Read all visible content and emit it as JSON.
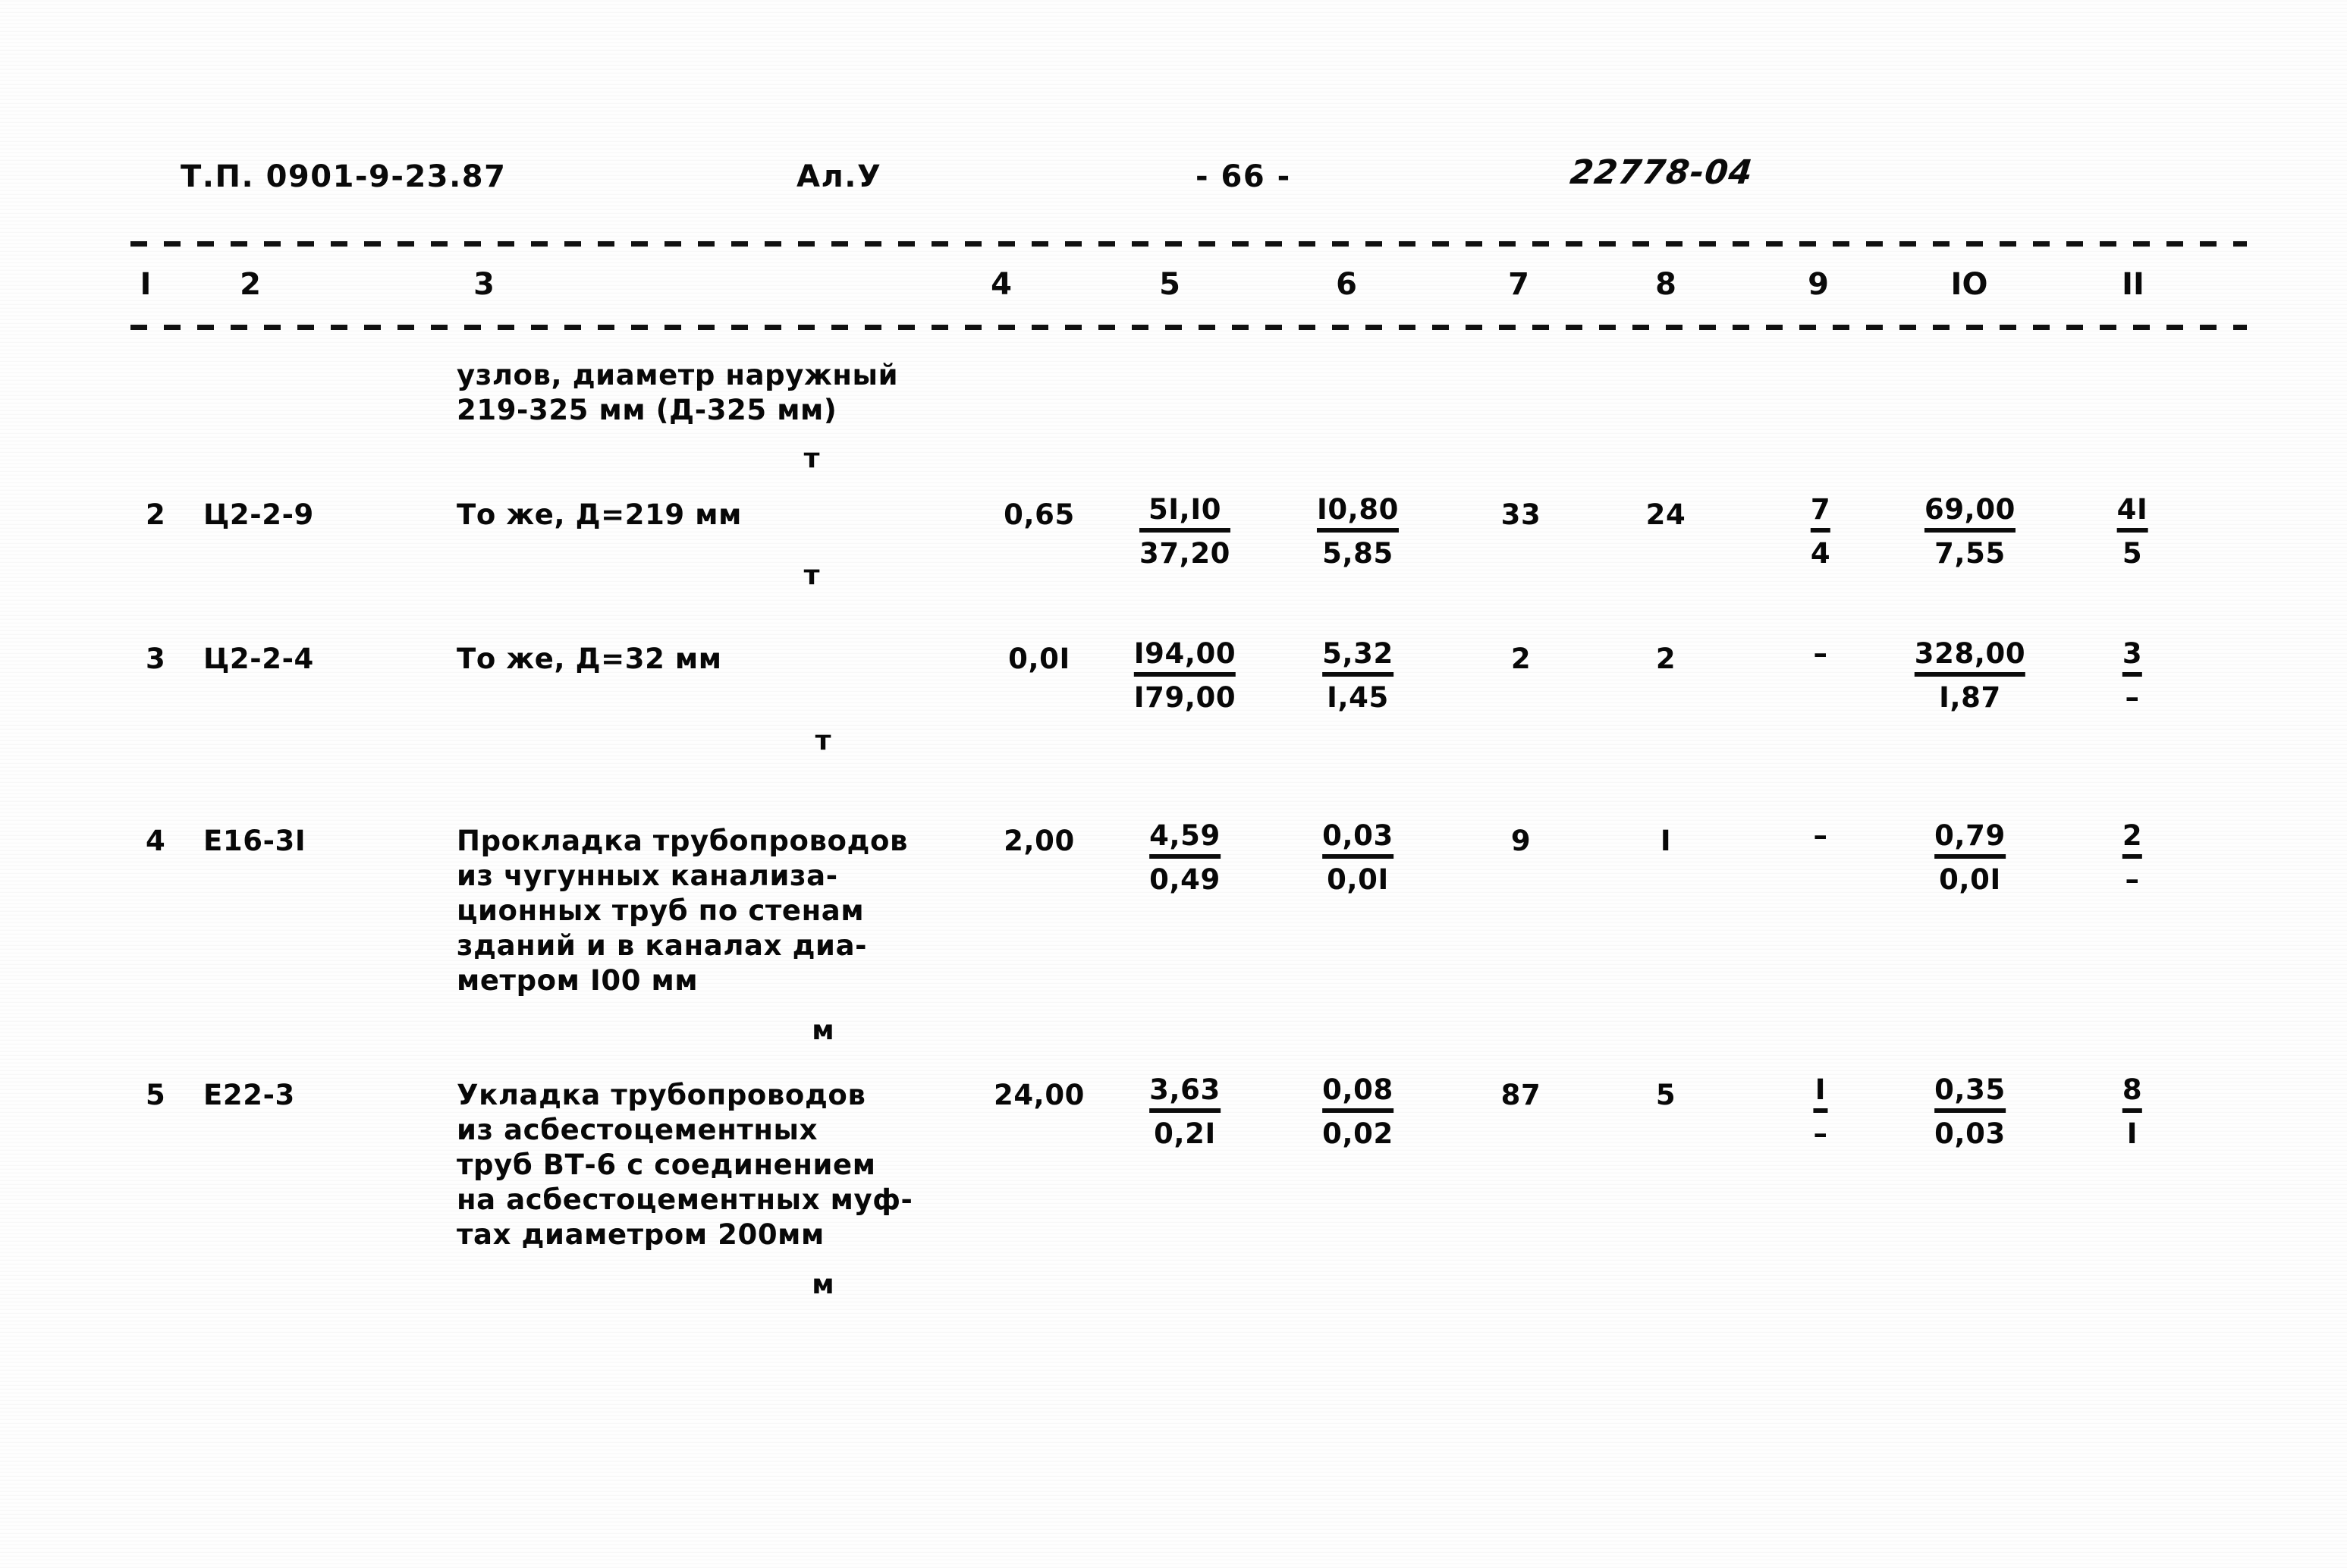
{
  "header": {
    "series": "Т.П. 0901-9-23.87",
    "album": "Ал.У",
    "page": "- 66 -",
    "doc_code": "22778-04"
  },
  "table": {
    "column_numbers": [
      "I",
      "2",
      "3",
      "4",
      "5",
      "6",
      "7",
      "8",
      "9",
      "IO",
      "II"
    ],
    "rows": [
      {
        "no": "",
        "code": "",
        "description": "узлов, диаметр наружный\n219-325 мм (Д-325 мм)",
        "unit": "т",
        "c4": "",
        "c5_top": "",
        "c5_bot": "",
        "c6_top": "",
        "c6_bot": "",
        "c7": "",
        "c8": "",
        "c9_top": "",
        "c9_bot": "",
        "c10_top": "",
        "c10_bot": "",
        "c11_top": "",
        "c11_bot": ""
      },
      {
        "no": "2",
        "code": "Ц2-2-9",
        "description": "То же, Д=219 мм",
        "unit": "т",
        "c4": "0,65",
        "c5_top": "5I,I0",
        "c5_bot": "37,20",
        "c6_top": "I0,80",
        "c6_bot": "5,85",
        "c7": "33",
        "c8": "24",
        "c9_top": "7",
        "c9_bot": "4",
        "c10_top": "69,00",
        "c10_bot": "7,55",
        "c11_top": "4I",
        "c11_bot": "5"
      },
      {
        "no": "3",
        "code": "Ц2-2-4",
        "description": "То же, Д=32 мм",
        "unit": "т",
        "c4": "0,0I",
        "c5_top": "I94,00",
        "c5_bot": "I79,00",
        "c6_top": "5,32",
        "c6_bot": "I,45",
        "c7": "2",
        "c8": "2",
        "c9_top": "–",
        "c9_bot": "",
        "c10_top": "328,00",
        "c10_bot": "I,87",
        "c11_top": "3",
        "c11_bot": "–"
      },
      {
        "no": "4",
        "code": "Е16-3I",
        "description": "Прокладка трубопроводов\nиз чугунных канализа-\nционных труб по стенам\nзданий и в каналах диа-\nметром I00 мм",
        "unit": "м",
        "c4": "2,00",
        "c5_top": "4,59",
        "c5_bot": "0,49",
        "c6_top": "0,03",
        "c6_bot": "0,0I",
        "c7": "9",
        "c8": "I",
        "c9_top": "–",
        "c9_bot": "",
        "c10_top": "0,79",
        "c10_bot": "0,0I",
        "c11_top": "2",
        "c11_bot": "–"
      },
      {
        "no": "5",
        "code": "Е22-3",
        "description": "Укладка трубопроводов\nиз  асбестоцементных\nтруб ВТ-6 с соединением\nна асбестоцементных муф-\nтах диаметром 200мм",
        "unit": "м",
        "c4": "24,00",
        "c5_top": "3,63",
        "c5_bot": "0,2I",
        "c6_top": "0,08",
        "c6_bot": "0,02",
        "c7": "87",
        "c8": "5",
        "c9_top": "I",
        "c9_bot": "–",
        "c10_top": "0,35",
        "c10_bot": "0,03",
        "c11_top": "8",
        "c11_bot": "I"
      }
    ]
  }
}
